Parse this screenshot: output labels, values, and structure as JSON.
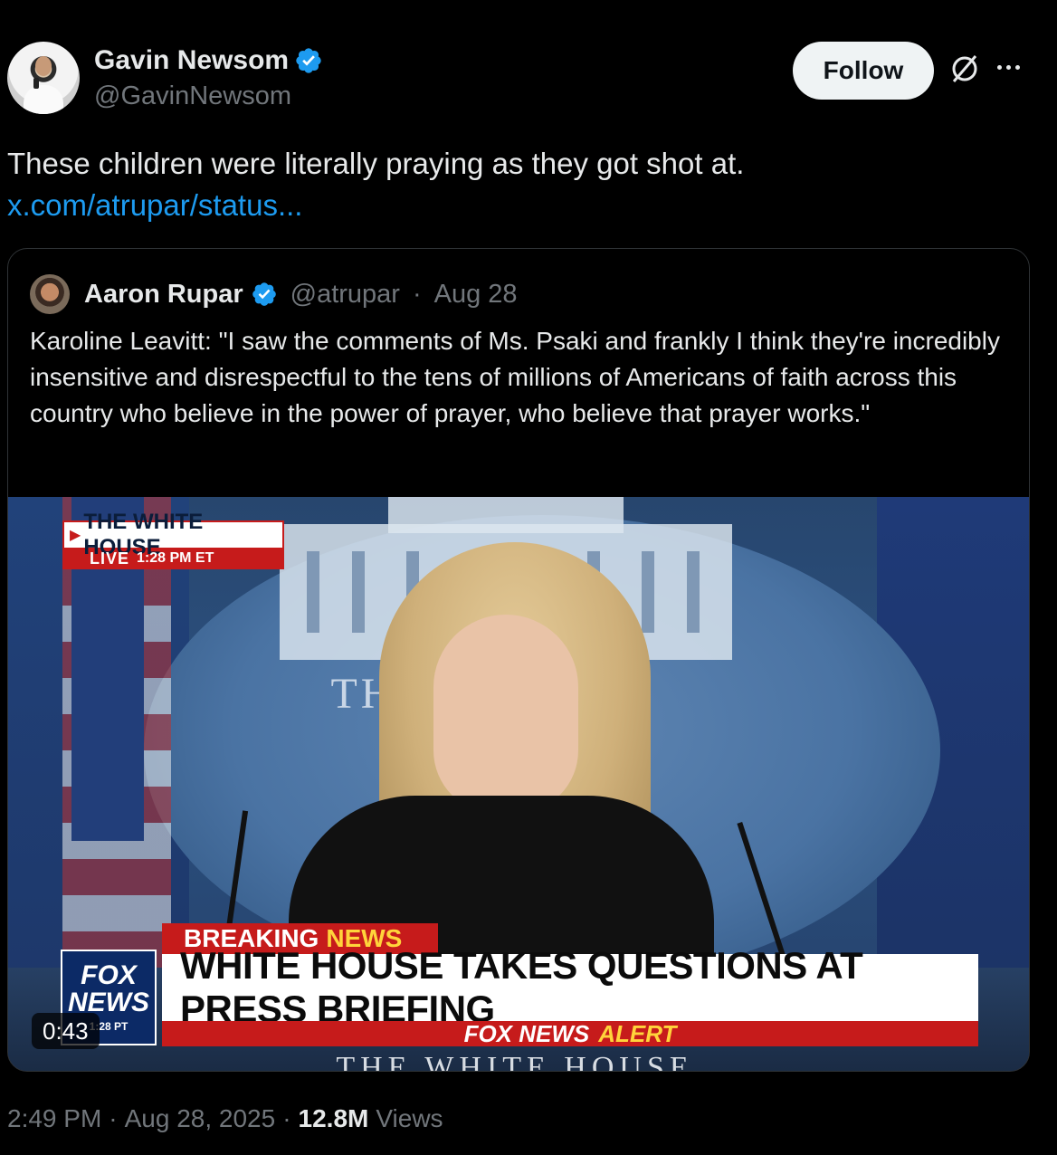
{
  "author": {
    "display_name": "Gavin Newsom",
    "handle": "@GavinNewsom"
  },
  "actions": {
    "follow_label": "Follow"
  },
  "tweet": {
    "text": "These children were literally praying as they got shot at.",
    "link": "x.com/atrupar/status..."
  },
  "quote": {
    "display_name": "Aaron Rupar",
    "handle": "@atrupar",
    "separator": "·",
    "date": "Aug 28",
    "text": "Karoline Leavitt: \"I saw the comments of Ms. Psaki and frankly I think they're incredibly insensitive and disrespectful to the tens of millions of Americans of faith across this country who believe in the power of prayer, who believe that prayer works.\"",
    "video": {
      "duration": "0:43",
      "location_tag": "THE WHITE HOUSE",
      "live_label": "LIVE",
      "live_time": "1:28 PM ET",
      "seal_text": "THE WH  USE",
      "breaking_label": "BREAKING",
      "breaking_news": "NEWS",
      "headline": "WHITE HOUSE TAKES QUESTIONS AT PRESS BRIEFING",
      "alert_prefix": "FOX NEWS",
      "alert_word": "ALERT",
      "network_logo_top": "FOX",
      "network_logo_bottom": "NEWS",
      "logo_time": "1:28 PT",
      "bottom_text": "THE WHITE HOUSE"
    }
  },
  "footer": {
    "time": "2:49 PM",
    "sep1": "·",
    "date": "Aug 28, 2025",
    "sep2": "·",
    "views_count": "12.8M",
    "views_label": "Views"
  },
  "colors": {
    "link": "#1d9bf0",
    "verified": "#1d9bf0",
    "muted": "#71767b",
    "fox_red": "#c61b1b",
    "fox_yellow": "#ffd43b"
  },
  "icons": [
    "verified-badge-icon",
    "grok-icon",
    "more-icon",
    "play-triangle-icon"
  ]
}
